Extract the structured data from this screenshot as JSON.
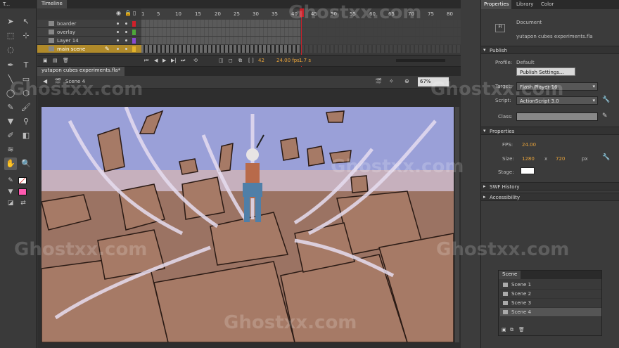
{
  "tools": {
    "tab": "T..."
  },
  "timeline": {
    "tab": "Timeline",
    "frame_numbers": [
      "1",
      "5",
      "10",
      "15",
      "20",
      "25",
      "30",
      "35",
      "40",
      "45",
      "50",
      "55",
      "60",
      "65",
      "70",
      "75",
      "80"
    ],
    "layers": [
      {
        "name": "boarder",
        "color": "#d0202a"
      },
      {
        "name": "overlay",
        "color": "#4ea83a"
      },
      {
        "name": "Layer 14",
        "color": "#8a4ad0"
      },
      {
        "name": "main scene",
        "color": "#e3b32a"
      }
    ],
    "current_frame": "42",
    "fps": "24.00 fps",
    "time": "1.7 s"
  },
  "document": {
    "tab": "yutapon cubes experiments.fla*",
    "scene": "Scene 4",
    "zoom": "67%"
  },
  "properties": {
    "tabs": [
      "Properties",
      "Library",
      "Color"
    ],
    "type": "Document",
    "filename": "yutapon cubes experiments.fla",
    "publish_header": "Publish",
    "profile_label": "Profile:",
    "profile_value": "Default",
    "publish_settings": "Publish Settings...",
    "target_label": "Target:",
    "target_value": "Flash Player 16",
    "script_label": "Script:",
    "script_value": "ActionScript 3.0",
    "class_label": "Class:",
    "props_header": "Properties",
    "fps_label": "FPS:",
    "fps_value": "24.00",
    "size_label": "Size:",
    "width": "1280",
    "x": "x",
    "height": "720",
    "px": "px",
    "stage_label": "Stage:",
    "swf_history": "SWF History",
    "accessibility": "Accessibility"
  },
  "scenes": {
    "tab": "Scene",
    "items": [
      "Scene 1",
      "Scene 2",
      "Scene 3",
      "Scene 4"
    ]
  },
  "watermark": "Ghostxx.com"
}
